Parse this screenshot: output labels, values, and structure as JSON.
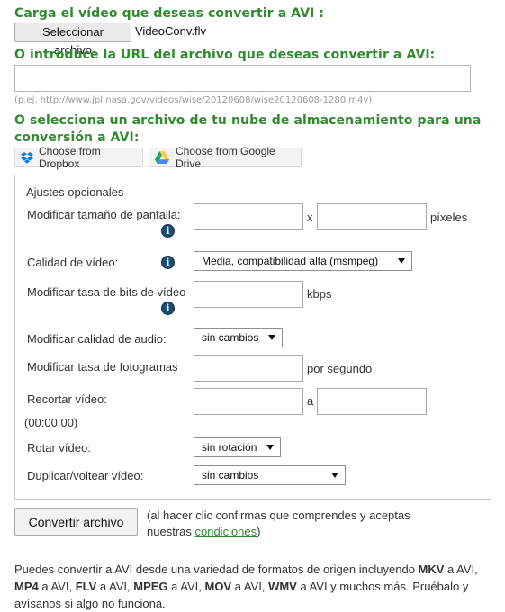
{
  "upload": {
    "heading": "Carga el vídeo que deseas convertir a AVI :",
    "file_button": "Seleccionar archivo",
    "file_name": "VideoConv.flv"
  },
  "url": {
    "heading": "O introduce la URL del archivo que deseas convertir a AVI:",
    "value": "",
    "hint": "(p.ej. http://www.jpl.nasa.gov/videos/wise/20120608/wise20120608-1280.m4v)"
  },
  "cloud": {
    "heading_line1": "O selecciona un archivo de tu nube de almacenamiento para una",
    "heading_line2": "conversión a AVI:",
    "dropbox_label": "Choose from Dropbox",
    "gdrive_label": "Choose from Google Drive"
  },
  "options": {
    "title": "Ajustes opcionales",
    "screen_size_label": "Modificar tamaño de pantalla:",
    "width_value": "",
    "x_separator": "x",
    "height_value": "",
    "pixels_unit": "píxeles",
    "quality_label": "Calidad de vídeo:",
    "quality_selected": "Media, compatibilidad alta (msmpeg)",
    "bitrate_label": "Modificar tasa de bits de vídeo",
    "bitrate_value": "",
    "bitrate_unit": "kbps",
    "audio_label": "Modificar calidad de audio:",
    "audio_selected": "sin cambios",
    "fps_label": "Modificar tasa de fotogramas",
    "fps_value": "",
    "fps_unit": "por segundo",
    "trim_label": "Recortar vídeo:",
    "trim_start": "",
    "trim_sep": "a",
    "trim_end": "",
    "trim_format": "(00:00:00)",
    "rotate_label": "Rotar vídeo:",
    "rotate_selected": "sin rotación",
    "flip_label": "Duplicar/voltear vídeo:",
    "flip_selected": "sin cambios",
    "info_glyph": "i"
  },
  "convert": {
    "button": "Convertir archivo",
    "note_line1": "(al hacer clic confirmas que comprendes y aceptas",
    "note_line2_prefix": "nuestras ",
    "note_link": "condiciones",
    "note_line2_suffix": ")"
  },
  "footer": {
    "t1": "Puedes convertir a AVI desde una variedad de formatos de origen incluyendo ",
    "b1": "MKV",
    "t2": " a AVI, ",
    "b2": "MP4",
    "t3": " a AVI, ",
    "b3": "FLV",
    "t4": " a AVI, ",
    "b4": "MPEG",
    "t5": " a AVI, ",
    "b5": "MOV",
    "t6": " a AVI, ",
    "b6": "WMV",
    "t7": " a AVI y muchos más. Pruébalo y avísanos si algo no funciona."
  },
  "colors": {
    "heading_green": "#2e8b2e",
    "info_blue": "#1d4e6e",
    "dropbox_blue": "#0d7ee0",
    "drive_green": "#1fa463",
    "drive_yellow": "#ffcd40",
    "drive_blue": "#4687f4"
  }
}
